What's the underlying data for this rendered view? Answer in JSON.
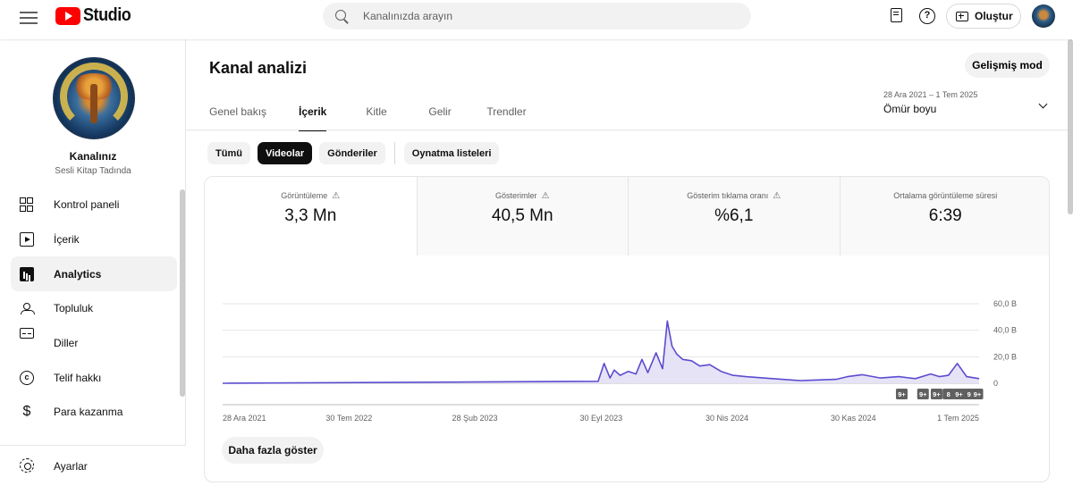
{
  "header": {
    "logo_text": "Studio",
    "search_placeholder": "Kanalınızda arayın",
    "create_label": "Oluştur",
    "help_glyph": "?"
  },
  "sidebar": {
    "channel_name": "Kanalınız",
    "channel_handle": "Sesli Kitap Tadında",
    "items": [
      {
        "label": "Kontrol paneli",
        "icon": "dashboard-icon"
      },
      {
        "label": "İçerik",
        "icon": "content-icon"
      },
      {
        "label": "Analytics",
        "icon": "analytics-icon",
        "active": true
      },
      {
        "label": "Topluluk",
        "icon": "community-icon"
      },
      {
        "label": "Diller",
        "icon": "subtitles-icon"
      },
      {
        "label": "Telif hakkı",
        "icon": "copyright-icon"
      },
      {
        "label": "Para kazanma",
        "icon": "dollar-icon"
      }
    ],
    "copyright_glyph": "c",
    "money_glyph": "$",
    "settings_label": "Ayarlar"
  },
  "main": {
    "title": "Kanal analizi",
    "advanced_label": "Gelişmiş mod",
    "tabs": [
      {
        "label": "Genel bakış"
      },
      {
        "label": "İçerik",
        "active": true
      },
      {
        "label": "Kitle"
      },
      {
        "label": "Gelir"
      },
      {
        "label": "Trendler"
      }
    ],
    "date_range": {
      "sub": "28 Ara 2021 – 1 Tem 2025",
      "main": "Ömür boyu"
    },
    "chips": [
      {
        "label": "Tümü"
      },
      {
        "label": "Videolar",
        "active": true
      },
      {
        "label": "Gönderiler"
      },
      {
        "label": "Oynatma listeleri"
      }
    ],
    "metrics": [
      {
        "label": "Görüntüleme",
        "value": "3,3 Mn"
      },
      {
        "label": "Gösterimler",
        "value": "40,5 Mn"
      },
      {
        "label": "Gösterim tıklama oranı",
        "value": "%6,1"
      },
      {
        "label": "Ortalama görüntüleme süresi",
        "value": "6:39"
      }
    ],
    "warning_glyph": "⚠",
    "more_label": "Daha fazla göster"
  },
  "chart_data": {
    "type": "area",
    "y_ticks": [
      "60,0 B",
      "40,0 B",
      "20,0 B",
      "0"
    ],
    "ylim": [
      0,
      60000
    ],
    "x_tick_labels": [
      "28 Ara 2021",
      "30 Tem 2022",
      "28 Şub 2023",
      "30 Eyl 2023",
      "30 Nis 2024",
      "30 Kas 2024",
      "1 Tem 2025"
    ],
    "x_tick_dates": [
      "2021-12-28",
      "2022-07-30",
      "2023-02-28",
      "2023-09-30",
      "2024-04-30",
      "2024-11-30",
      "2025-07-01"
    ],
    "color": "#5c4ccf",
    "fill": "#e6e3f7",
    "grid": true,
    "series": [
      {
        "x": [
          "2021-12-28",
          "2023-09-25",
          "2023-10-05",
          "2023-10-15",
          "2023-10-22",
          "2023-11-01",
          "2023-11-15",
          "2023-11-28",
          "2023-12-08",
          "2023-12-18",
          "2024-01-01",
          "2024-01-12",
          "2024-01-20",
          "2024-01-28",
          "2024-02-05",
          "2024-02-15",
          "2024-03-01",
          "2024-03-15",
          "2024-04-01",
          "2024-04-20",
          "2024-05-10",
          "2024-06-01",
          "2024-07-01",
          "2024-08-01",
          "2024-09-01",
          "2024-10-01",
          "2024-11-01",
          "2024-11-20",
          "2024-12-15",
          "2025-01-15",
          "2025-02-15",
          "2025-03-15",
          "2025-04-10",
          "2025-04-25",
          "2025-05-10",
          "2025-05-25",
          "2025-06-10",
          "2025-07-01"
        ],
        "y": [
          0,
          1500,
          15000,
          4000,
          10000,
          6000,
          9000,
          7000,
          18000,
          8000,
          23000,
          11000,
          47000,
          28000,
          22000,
          18000,
          17000,
          13000,
          14000,
          9000,
          6000,
          5000,
          4000,
          3000,
          2000,
          2500,
          3000,
          5000,
          6500,
          4000,
          5000,
          3500,
          7000,
          5000,
          6000,
          15000,
          5000,
          3500
        ]
      }
    ],
    "markers": [
      "9+",
      "9+",
      "9+",
      "8",
      "9+",
      "9",
      "9+"
    ],
    "marker_dates": [
      "2025-02-20",
      "2025-03-28",
      "2025-04-20",
      "2025-05-10",
      "2025-05-28",
      "2025-06-14",
      "2025-06-28"
    ]
  }
}
